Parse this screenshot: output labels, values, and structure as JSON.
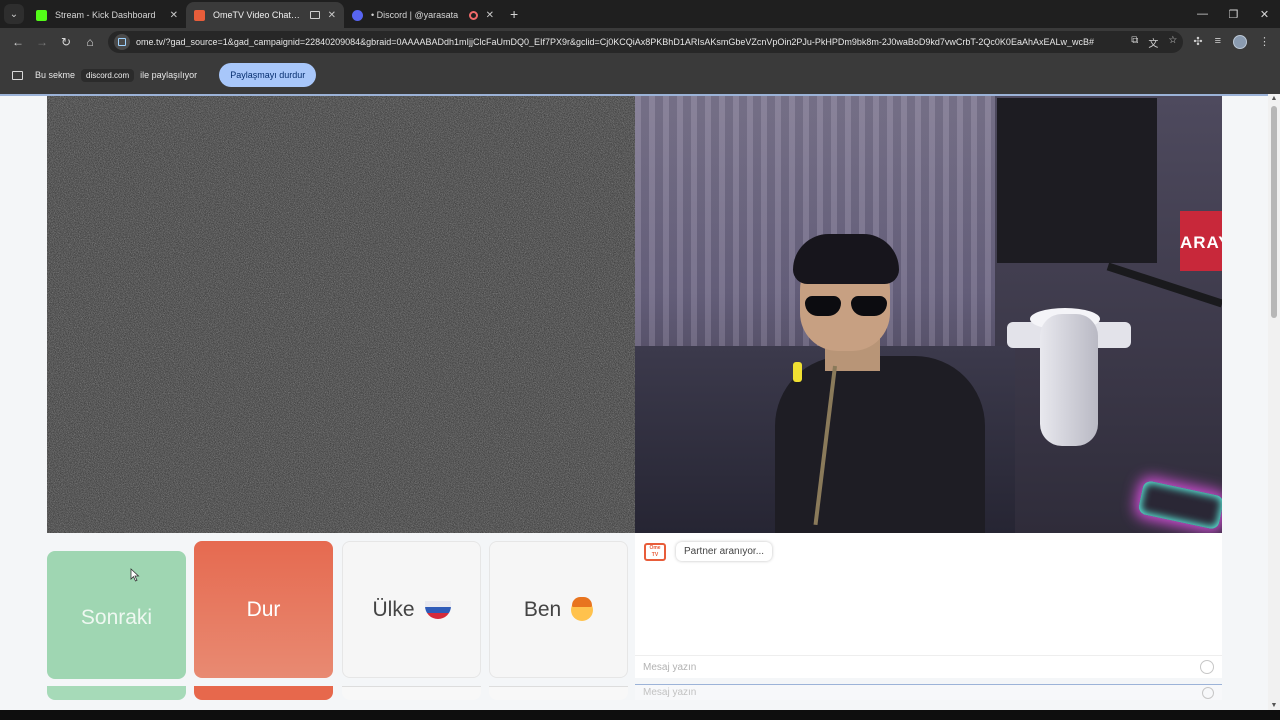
{
  "browser": {
    "tabs": [
      {
        "title": "Stream - Kick Dashboard",
        "favicon": "kick-favicon",
        "active": false
      },
      {
        "title": "OmeTV Video Chat — Ome",
        "favicon": "ometv-favicon",
        "active": true
      },
      {
        "title": "• Discord | @yarasata",
        "favicon": "discord-favicon",
        "active": false
      }
    ],
    "new_tab": "+",
    "window_controls": {
      "minimize": "—",
      "restore": "❐",
      "close": "✕"
    },
    "url": "ome.tv/?gad_source=1&gad_campaignid=22840209084&gbraid=0AAAABADdh1mIjjClcFaUmDQ0_EIf7PX9r&gclid=Cj0KCQiAx8PKBhD1ARIsAKsmGbeVZcnVpOin2PJu-PkHPDm9bk8m-2J0waBoD9kd7vwCrbT-2Qc0K0EaAhAxEALw_wcB#"
  },
  "sharing_bar": {
    "prefix": "Bu sekme",
    "target": "discord.com",
    "suffix": "ile paylaşılıyor",
    "stop_button": "Paylaşmayı durdur"
  },
  "controls": {
    "next": "Sonraki",
    "stop": "Dur",
    "country": "Ülke",
    "me": "Ben"
  },
  "chat": {
    "logo_text": "Ome TV",
    "status": "Partner aranıyor...",
    "input_placeholder": "Mesaj yazın"
  },
  "webcam_overlay_text": "ARAY",
  "colors": {
    "next_button": "#9fd6b2",
    "stop_button": "#e66a50",
    "share_stop": "#a8c7fa"
  }
}
